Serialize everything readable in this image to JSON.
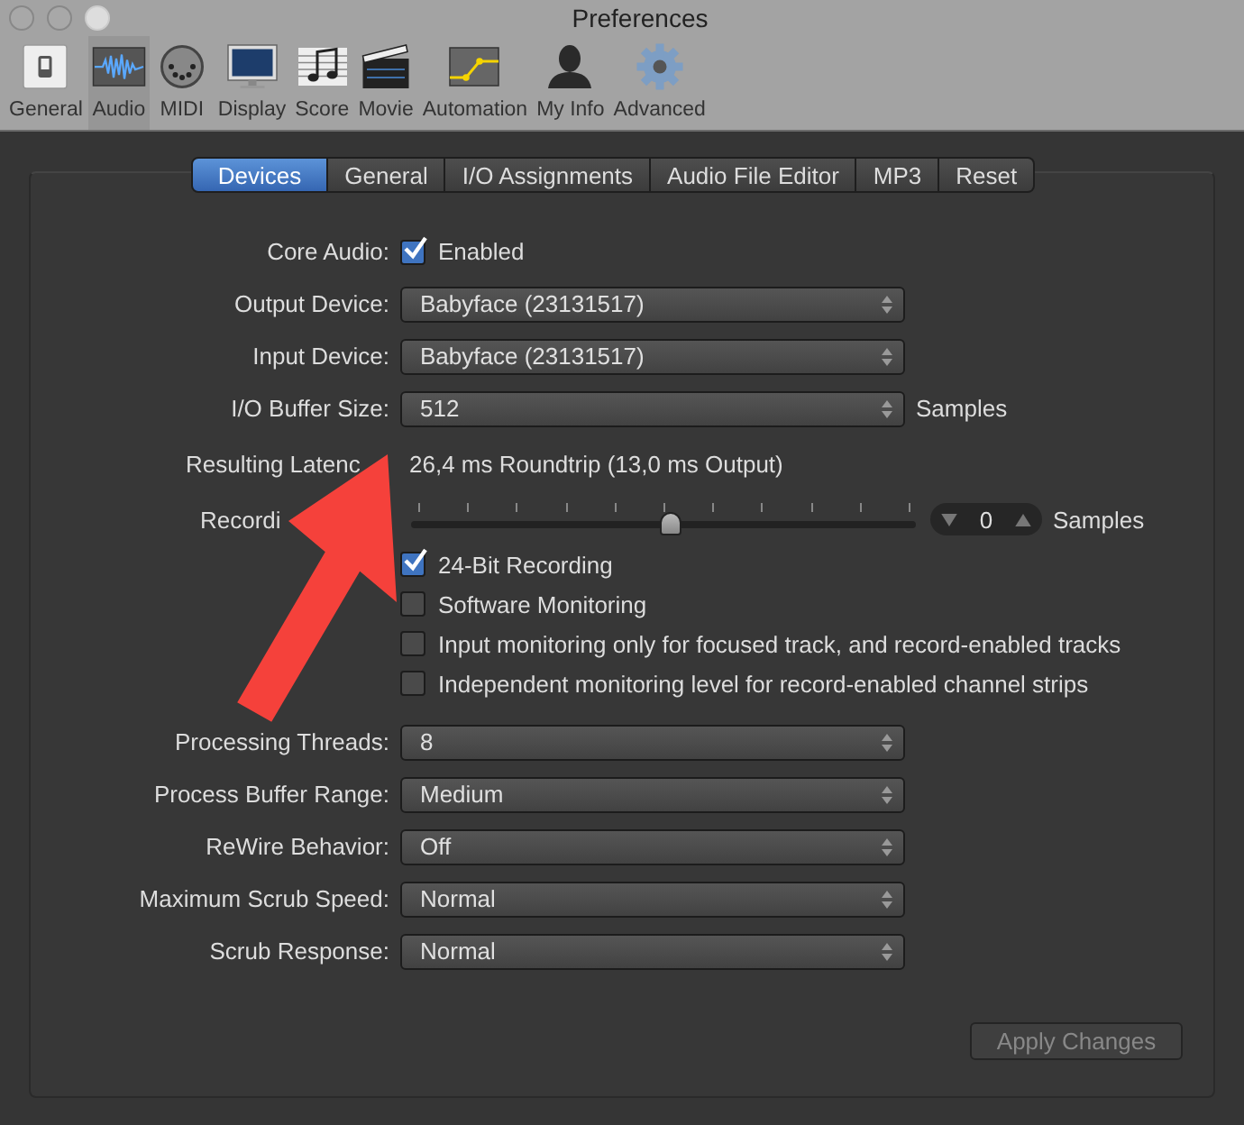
{
  "window": {
    "title": "Preferences"
  },
  "toolbar": [
    {
      "label": "General",
      "selected": false
    },
    {
      "label": "Audio",
      "selected": true
    },
    {
      "label": "MIDI",
      "selected": false
    },
    {
      "label": "Display",
      "selected": false
    },
    {
      "label": "Score",
      "selected": false
    },
    {
      "label": "Movie",
      "selected": false
    },
    {
      "label": "Automation",
      "selected": false
    },
    {
      "label": "My Info",
      "selected": false
    },
    {
      "label": "Advanced",
      "selected": false
    }
  ],
  "tabs": [
    {
      "label": "Devices",
      "selected": true
    },
    {
      "label": "General",
      "selected": false
    },
    {
      "label": "I/O Assignments",
      "selected": false
    },
    {
      "label": "Audio File Editor",
      "selected": false
    },
    {
      "label": "MP3",
      "selected": false
    },
    {
      "label": "Reset",
      "selected": false
    }
  ],
  "rows": [
    {
      "kind": "checkbox",
      "label": "Core Audio:",
      "text": "Enabled",
      "checked": true
    },
    {
      "kind": "popup",
      "label": "Output Device:",
      "value": "Babyface (23131517)"
    },
    {
      "kind": "popup",
      "label": "Input Device:",
      "value": "Babyface (23131517)"
    },
    {
      "kind": "popup",
      "label": "I/O Buffer Size:",
      "value": "512",
      "suffix": "Samples"
    },
    {
      "kind": "text",
      "label": "Resulting Latenc",
      "value": "26,4 ms Roundtrip (13,0 ms Output)"
    },
    {
      "kind": "slider",
      "label": "Recordi",
      "level": 0.5,
      "stepper": "0",
      "suffix": "Samples"
    },
    {
      "kind": "option",
      "text": "24-Bit Recording",
      "checked": true
    },
    {
      "kind": "option",
      "text": "Software Monitoring",
      "checked": false
    },
    {
      "kind": "option",
      "text": "Input monitoring only for focused track, and record-enabled tracks",
      "checked": false
    },
    {
      "kind": "option",
      "text": "Independent monitoring level for record-enabled channel strips",
      "checked": false
    },
    {
      "kind": "popup",
      "label": "Processing Threads:",
      "value": "8"
    },
    {
      "kind": "popup",
      "label": "Process Buffer Range:",
      "value": "Medium"
    },
    {
      "kind": "popup",
      "label": "ReWire Behavior:",
      "value": "Off"
    },
    {
      "kind": "popup",
      "label": "Maximum Scrub Speed:",
      "value": "Normal"
    },
    {
      "kind": "popup",
      "label": "Scrub Response:",
      "value": "Normal"
    }
  ],
  "apply_button": {
    "label": "Apply Changes",
    "disabled": true
  }
}
